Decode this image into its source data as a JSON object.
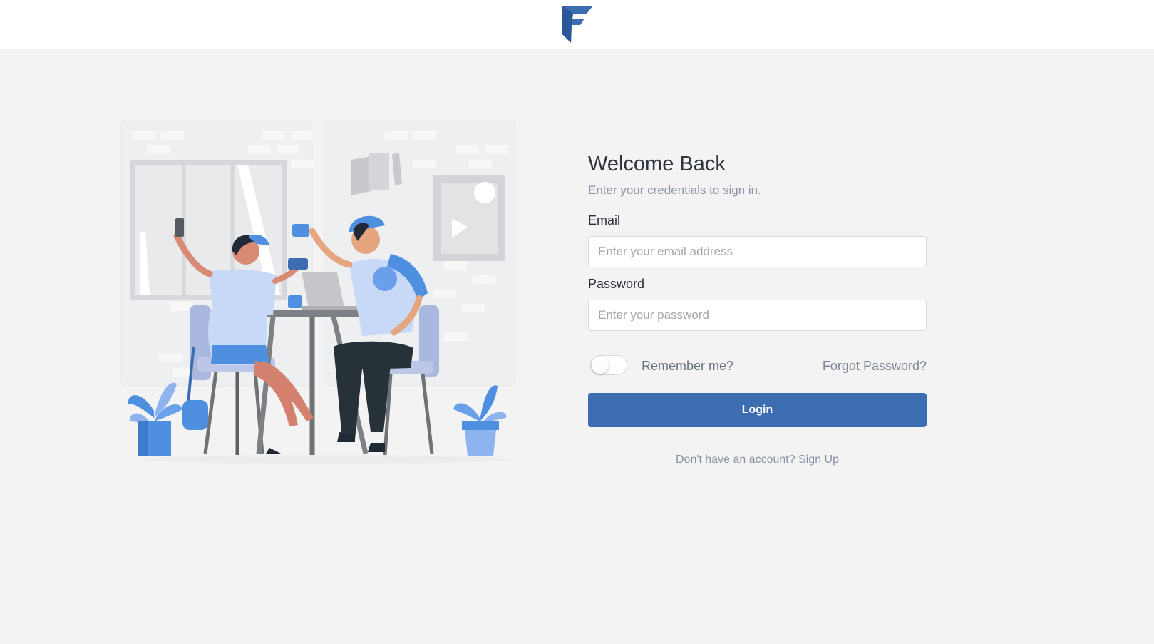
{
  "header": {
    "logo_icon": "brand-logo-f-icon"
  },
  "illustration": {
    "name": "people-using-devices-at-table-illustration"
  },
  "form": {
    "title": "Welcome Back",
    "subtitle": "Enter your credentials to sign in.",
    "email": {
      "label": "Email",
      "placeholder": "Enter your email address",
      "value": ""
    },
    "password": {
      "label": "Password",
      "placeholder": "Enter your password",
      "value": ""
    },
    "remember": {
      "label": "Remember me?",
      "checked": false
    },
    "forgot_label": "Forgot Password?",
    "login_label": "Login",
    "signup": {
      "prompt": "Don't have an account?",
      "link_label": "Sign Up"
    }
  },
  "colors": {
    "accent": "#3d6db1",
    "page_background": "#f3f3f3",
    "header_background": "#ffffff",
    "illustration_blue": "#4f8fe0",
    "illustration_light_blue": "#bcd2f5",
    "text_dark": "#2f3440",
    "text_muted": "#8b92a6"
  }
}
